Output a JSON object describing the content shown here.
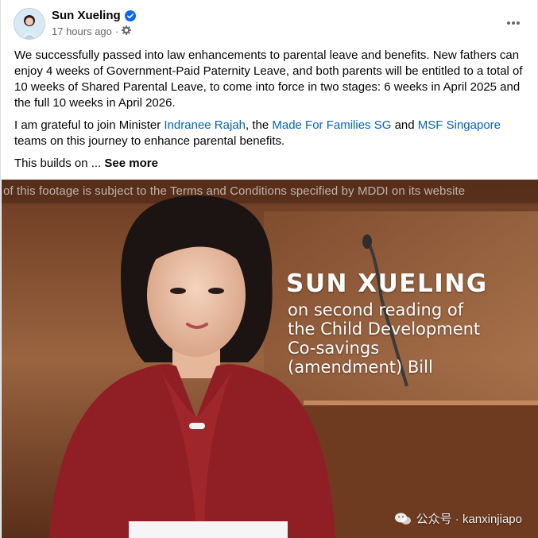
{
  "post": {
    "author": "Sun Xueling",
    "verified": true,
    "timestamp": "17 hours ago",
    "audience_icon": "gear-icon",
    "more_icon": "more-horizontal-icon",
    "body": {
      "p1": "We successfully passed into law enhancements to parental leave and benefits.  New fathers can enjoy 4 weeks of Government-Paid Paternity Leave, and both parents will be entitled to a total of 10 weeks of Shared Parental Leave, to come into force in two stages: 6 weeks in April 2025 and the full 10 weeks in April 2026.",
      "p2_prefix": "I am grateful to join Minister ",
      "p2_link1": "Indranee Rajah",
      "p2_mid1": ", the ",
      "p2_link2": "Made For Families SG",
      "p2_mid2": " and ",
      "p2_link3": "MSF Singapore",
      "p2_suffix": " teams on this journey to enhance parental benefits.",
      "p3_prefix": "This builds on ... ",
      "see_more": "See more"
    }
  },
  "media": {
    "disclaimer": "of this footage is subject to the Terms and Conditions specified by MDDI on its website",
    "caption_title": "SUN XUELING",
    "caption_lines": [
      "on second reading of",
      "the Child Development",
      "Co-savings",
      "(amendment) Bill"
    ],
    "watermark": "公众号 · kanxinjiapo"
  },
  "colors": {
    "link": "#0064d1",
    "verified_badge": "#0866ff",
    "secondary_text": "#65676b"
  }
}
